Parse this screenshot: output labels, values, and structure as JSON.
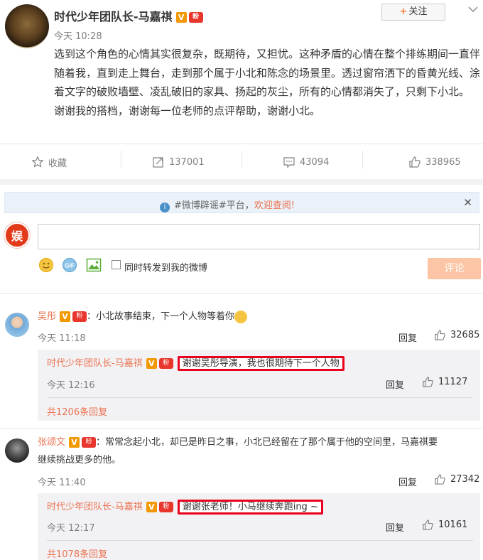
{
  "post": {
    "author": "时代少年团队长-马嘉祺",
    "v_badge": "V",
    "fan_badge": "粉",
    "follow_label": "关注",
    "time": "今天 10:28",
    "text": "选到这个角色的心情其实很复杂，既期待，又担忧。这种矛盾的心情在整个排练期间一直伴随着我，直到走上舞台，走到那个属于小北和陈念的场景里。透过窗帘洒下的昏黄光线、涂着文字的破败墙壁、凌乱破旧的家具、扬起的灰尘，所有的心情都消失了，只剩下小北。",
    "text2": "谢谢我的搭档，谢谢每一位老师的点评帮助，谢谢小北。",
    "actions": {
      "favorite": "收藏",
      "repost_count": "137001",
      "comment_count": "43094",
      "like_count": "338965"
    }
  },
  "notice": {
    "prefix": "#微博辟谣#平台，",
    "link": "欢迎查阅!"
  },
  "composer": {
    "checkbox_label": "同时转发到我的微博",
    "submit_label": "评论"
  },
  "comments": [
    {
      "user": "吴彤",
      "text": "：小北故事结束，下一个人物等着你",
      "time": "今天 11:18",
      "reply_label": "回复",
      "likes": "32685",
      "reply": {
        "user": "时代少年团队长-马嘉祺",
        "text": "谢谢吴彤导演，我也很期待下一个人物",
        "time": "今天 12:16",
        "reply_label": "回复",
        "likes": "11127"
      },
      "total": "共1206条回复"
    },
    {
      "user": "张颂文",
      "text": "：常常念起小北，却已是昨日之事，小北已经留在了那个属于他的空间里，马嘉祺要",
      "text2": "继续挑战更多的他。",
      "time": "今天 11:40",
      "reply_label": "回复",
      "likes": "27342",
      "reply": {
        "user": "时代少年团队长-马嘉祺",
        "text": "谢谢张老师！小马继续奔跑ing ~",
        "time": "今天 12:17",
        "reply_label": "回复",
        "likes": "10161"
      },
      "total": "共1078条回复"
    }
  ],
  "colors": {
    "accent": "#eb7350",
    "highlight_border": "#e8001c",
    "submit_bg": "#fcc6a6",
    "notice_bg": "#eaf1f9"
  }
}
